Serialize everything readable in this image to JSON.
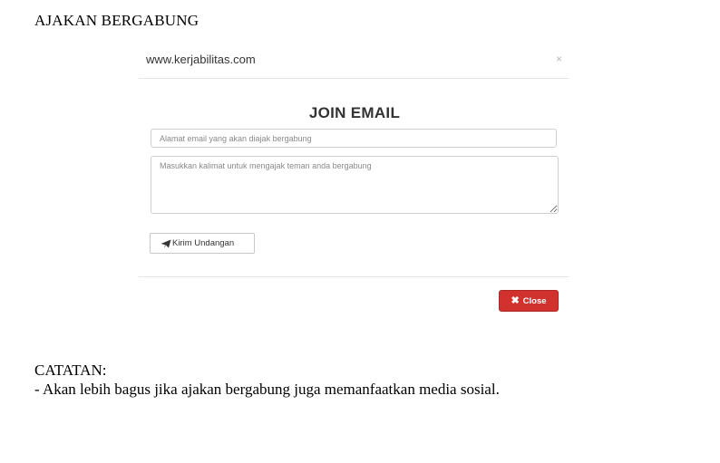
{
  "page": {
    "heading": "AJAKAN BERGABUNG"
  },
  "modal": {
    "site_title": "www.kerjabilitas.com",
    "close_x": "×",
    "title": "JOIN EMAIL",
    "email_placeholder": "Alamat email yang akan diajak bergabung",
    "message_placeholder": "Masukkan kalimat untuk mengajak teman anda bergabung",
    "send_label": "Kirim Undangan",
    "send_icon": "paper-plane-icon",
    "close_label": "Close",
    "close_icon": "✖",
    "close_color": "#d2322d"
  },
  "note": {
    "title": "CATATAN:",
    "text": "- Akan lebih bagus jika ajakan bergabung juga memanfaatkan media sosial."
  }
}
